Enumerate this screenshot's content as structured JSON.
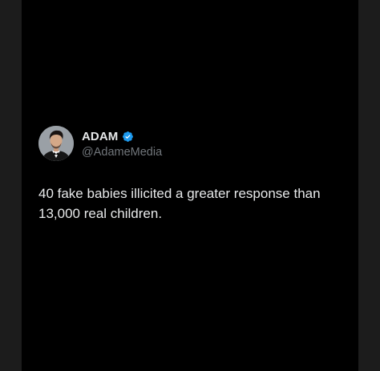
{
  "tweet": {
    "author": {
      "display_name": "ADAM",
      "handle": "@AdameMedia",
      "verified": true,
      "avatar_icon": "profile-photo",
      "badge_icon": "verified-badge-icon",
      "badge_color": "#1d9bf0"
    },
    "text": "40 fake babies illicited a greater response than 13,000 real children."
  },
  "colors": {
    "background": "#000000",
    "outer_frame": "#1c1c1c",
    "primary_text": "#e7e9ea",
    "secondary_text": "#71767b"
  }
}
